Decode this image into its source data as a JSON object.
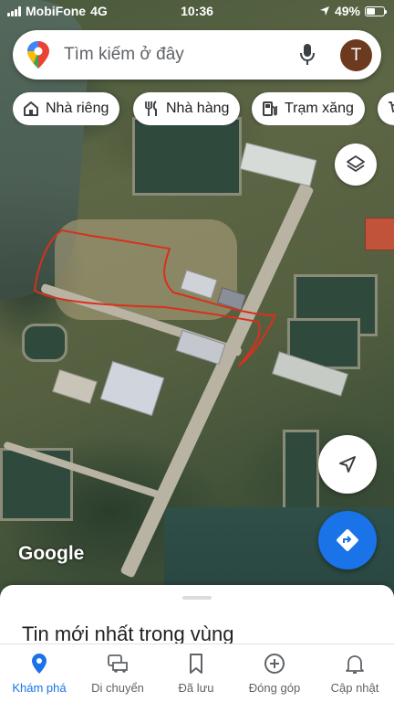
{
  "status_bar": {
    "carrier": "MobiFone",
    "network": "4G",
    "time": "10:36",
    "battery": "49%",
    "battery_level": 0.49
  },
  "search": {
    "placeholder": "Tìm kiếm ở đây",
    "avatar_initial": "T"
  },
  "chips": [
    {
      "label": "Nhà riêng",
      "icon": "home-icon"
    },
    {
      "label": "Nhà hàng",
      "icon": "restaurant-icon"
    },
    {
      "label": "Trạm xăng",
      "icon": "gas-station-icon"
    },
    {
      "label": "",
      "icon": "shopping-icon"
    }
  ],
  "map": {
    "attribution": "Google"
  },
  "sheet": {
    "title": "Tin mới nhất trong vùng"
  },
  "nav": {
    "items": [
      {
        "label": "Khám phá",
        "icon": "explore-pin-icon",
        "active": true
      },
      {
        "label": "Di chuyển",
        "icon": "commute-car-icon",
        "active": false
      },
      {
        "label": "Đã lưu",
        "icon": "bookmark-icon",
        "active": false
      },
      {
        "label": "Đóng góp",
        "icon": "add-circle-icon",
        "active": false
      },
      {
        "label": "Cập nhật",
        "icon": "bell-icon",
        "active": false
      }
    ]
  },
  "colors": {
    "accent": "#1a73e8",
    "drawn_outline": "#d9301c",
    "avatar_bg": "#6b3a1f"
  }
}
